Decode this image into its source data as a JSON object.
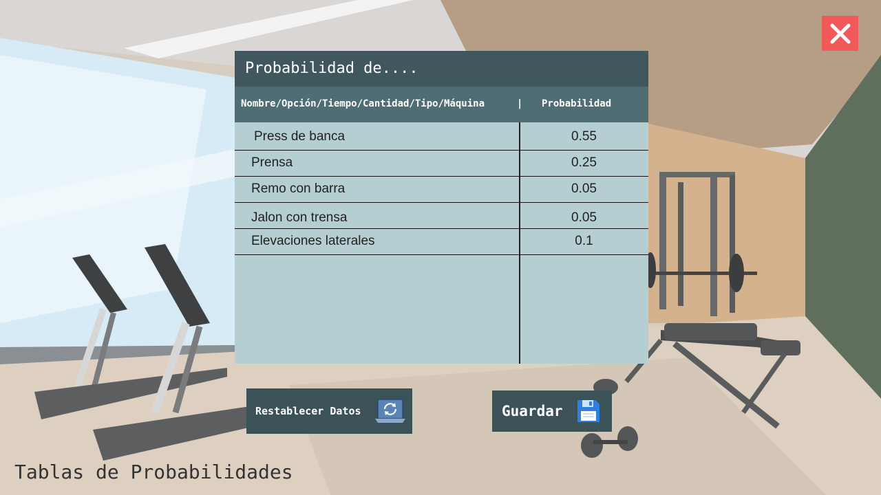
{
  "header": {
    "title": "Probabilidad de...."
  },
  "table": {
    "col_name": "Nombre/Opción/Tiempo/Cantidad/Tipo/Máquina",
    "col_sep": "|",
    "col_prob": "Probabilidad",
    "rows": [
      {
        "name": "Press de banca",
        "prob": "0.55"
      },
      {
        "name": "Prensa",
        "prob": "0.25"
      },
      {
        "name": "Remo con barra",
        "prob": "0.05"
      },
      {
        "name": "Jalon con trensa",
        "prob": "0.05"
      },
      {
        "name": "Elevaciones laterales",
        "prob": "0.1"
      }
    ]
  },
  "buttons": {
    "reset_label": "Restablecer Datos",
    "reset_icon": "refresh-laptop-icon",
    "save_label": "Guardar",
    "save_icon": "floppy-disk-icon",
    "close_icon": "close-icon"
  },
  "footer": {
    "title": "Tablas de Probabilidades"
  },
  "colors": {
    "panel_header": "#3f575d",
    "column_header": "#4f6e74",
    "panel_body": "#b5ced2",
    "close_button": "#f05a5a",
    "button_bg": "#3a5258"
  }
}
